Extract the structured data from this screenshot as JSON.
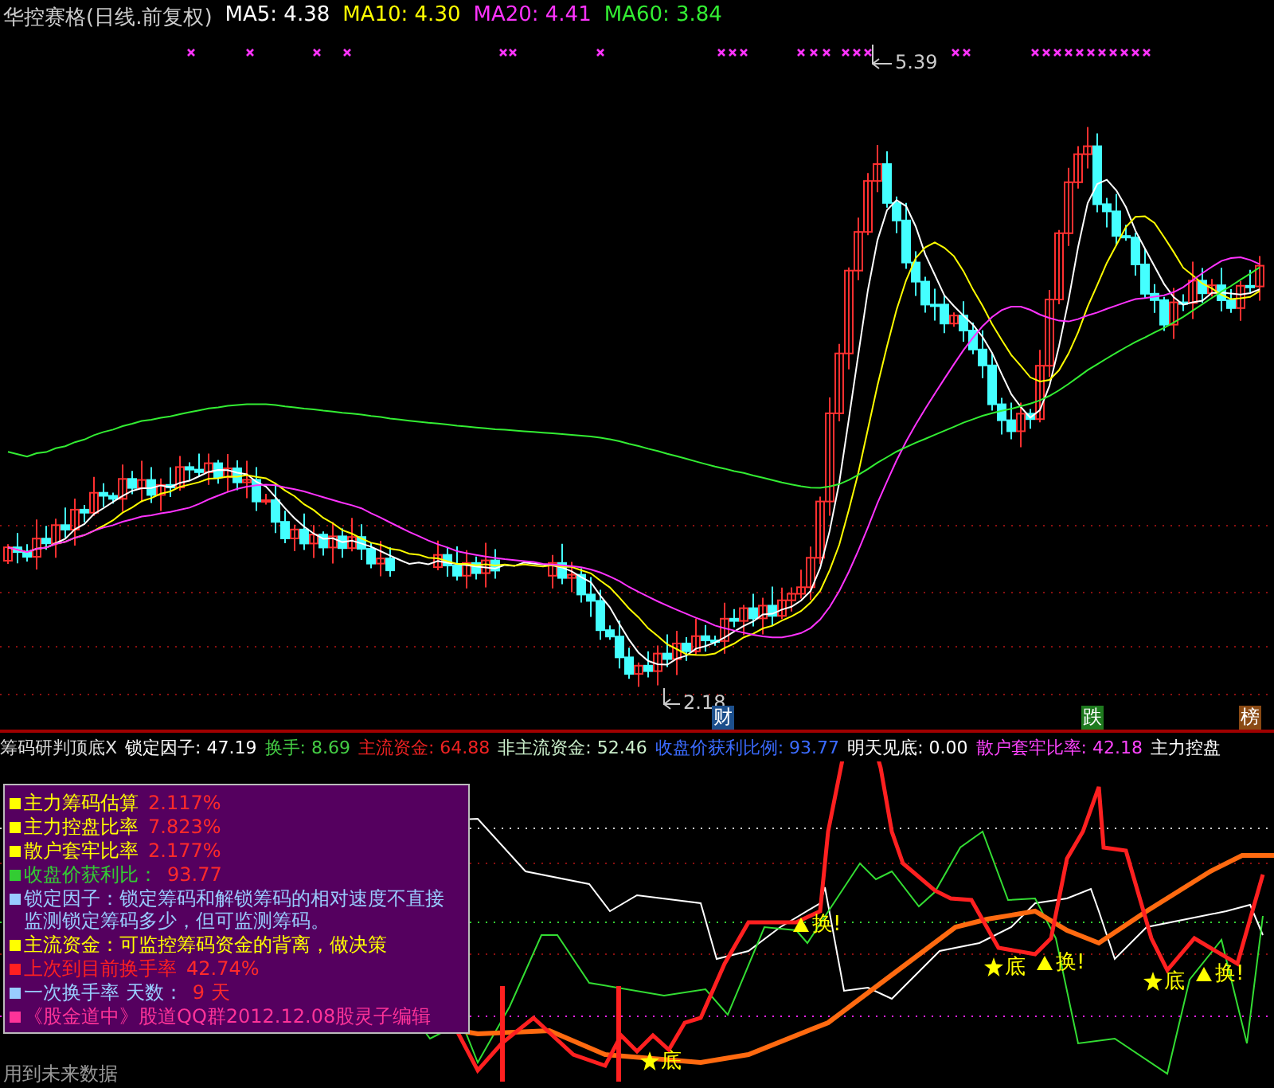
{
  "price_chart": {
    "title": "华控赛格(日线.前复权)",
    "ma_legend": [
      {
        "label": "MA5: 4.38",
        "color": "#ffffff"
      },
      {
        "label": "MA10: 4.30",
        "color": "#ffff00"
      },
      {
        "label": "MA20: 4.41",
        "color": "#ff33ff"
      },
      {
        "label": "MA60: 3.84",
        "color": "#33ee33"
      }
    ],
    "high_label": "5.39",
    "low_label": "2.18",
    "event_tags": [
      {
        "text": "财",
        "color": "#1c4f8c"
      },
      {
        "text": "跌",
        "color": "#1e7a1e"
      },
      {
        "text": "榜",
        "color": "#8a4a14"
      }
    ]
  },
  "indicator": {
    "header": [
      {
        "text": "筹码研判顶底X",
        "color": "#dddddd"
      },
      {
        "text": "锁定因子: 47.19",
        "color": "#ffffff"
      },
      {
        "text": "换手: 8.69",
        "color": "#44cc44"
      },
      {
        "text": "主流资金: 64.88",
        "color": "#ee2222"
      },
      {
        "text": "非主流资金: 52.46",
        "color": "#ccf0cc"
      },
      {
        "text": "收盘价获利比例: 93.77",
        "color": "#3b6bff"
      },
      {
        "text": "明天见底: 0.00",
        "color": "#ffffff"
      },
      {
        "text": "散户套牢比率: 42.18",
        "color": "#ff44ff"
      },
      {
        "text": "主力控盘",
        "color": "#ffffff"
      }
    ],
    "info_panel": [
      {
        "kind": "stat",
        "label": "主力筹码估算",
        "value": "2.117%",
        "color": "#ffff00"
      },
      {
        "kind": "stat",
        "label": "主力控盘比率",
        "value": "7.823%",
        "color": "#ffff00"
      },
      {
        "kind": "stat",
        "label": "散户套牢比率",
        "value": "2.177%",
        "color": "#ffff00"
      },
      {
        "kind": "stat",
        "label": "收盘价获利比：",
        "value": "93.77",
        "color": "#33cc33"
      },
      {
        "kind": "note",
        "text": "锁定因子：锁定筹码和解锁筹码的相对速度不直接监测锁定筹码多少，但可监测筹码。",
        "color": "#99ccff"
      },
      {
        "kind": "note",
        "text": "主流资金：可监控筹码资金的背离，做决策",
        "color": "#ffff00"
      },
      {
        "kind": "stat",
        "label": "上次到目前换手率",
        "value": "42.74%",
        "color": "#ff2020"
      },
      {
        "kind": "stat",
        "label": "一次换手率 天数：",
        "value": "9 天",
        "color": "#99ccff"
      },
      {
        "kind": "note",
        "text": "《股金道中》股道QQ群2012.12.08股灵子编辑",
        "color": "#ff3399"
      }
    ],
    "signals": [
      {
        "kind": "bottom",
        "text": "底"
      },
      {
        "kind": "turnover",
        "text": "换!"
      },
      {
        "kind": "bottom",
        "text": "底"
      },
      {
        "kind": "turnover",
        "text": "换!"
      },
      {
        "kind": "bottom",
        "text": "底"
      },
      {
        "kind": "turnover",
        "text": "换!"
      }
    ],
    "footnote": "用到未来数据"
  }
}
